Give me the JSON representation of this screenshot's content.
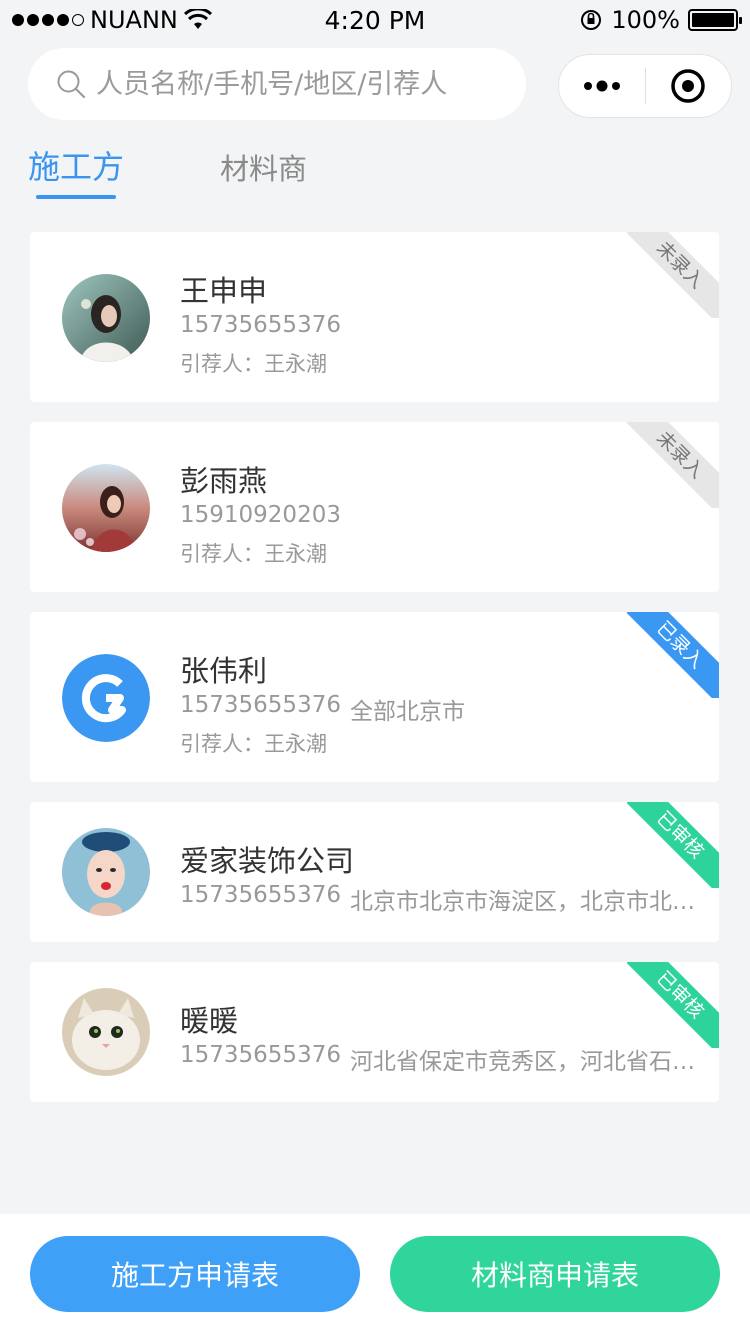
{
  "status_bar": {
    "carrier": "NUANN",
    "time": "4:20 PM",
    "battery": "100%"
  },
  "search": {
    "placeholder": "人员名称/手机号/地区/引荐人"
  },
  "tabs": [
    {
      "label": "施工方",
      "active": true
    },
    {
      "label": "材料商",
      "active": false
    }
  ],
  "cards": [
    {
      "name": "王申申",
      "phone": "15735655376",
      "region": "",
      "referrer": "引荐人：王永潮",
      "status": "未录入",
      "status_color": "#e6e6e6",
      "avatar": "portrait-photo"
    },
    {
      "name": "彭雨燕",
      "phone": "15910920203",
      "region": "",
      "referrer": "引荐人：王永潮",
      "status": "未录入",
      "status_color": "#e6e6e6",
      "avatar": "portrait-photo"
    },
    {
      "name": "张伟利",
      "phone": "15735655376",
      "region": "全部北京市",
      "referrer": "引荐人：王永潮",
      "status": "已录入",
      "status_color": "#3a98f3",
      "avatar": "brand-logo"
    },
    {
      "name": "爱家装饰公司",
      "phone": "15735655376",
      "region": "北京市北京市海淀区，北京市北京...",
      "referrer": "",
      "status": "已审核",
      "status_color": "#2ed39b",
      "avatar": "portrait-illustration"
    },
    {
      "name": "暖暖",
      "phone": "15735655376",
      "region": "河北省保定市竞秀区，河北省石家...",
      "referrer": "",
      "status": "已审核",
      "status_color": "#2ed39b",
      "avatar": "cat-photo"
    }
  ],
  "buttons": {
    "contractor_form": "施工方申请表",
    "supplier_form": "材料商申请表"
  },
  "colors": {
    "accent_blue": "#3b95f0",
    "accent_green": "#2fd59a"
  }
}
